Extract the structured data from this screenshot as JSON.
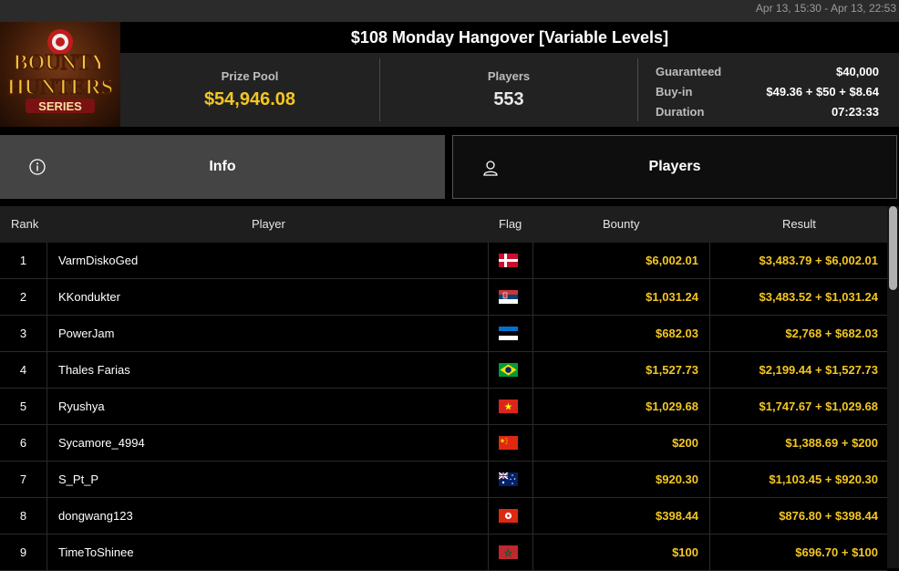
{
  "date_range": "Apr 13, 15:30 - Apr 13, 22:53",
  "logo": {
    "line1": "BOUNTY",
    "line2": "HUNTERS",
    "line3": "SERIES"
  },
  "tournament": {
    "title": "$108 Monday Hangover [Variable Levels]",
    "prize_pool_label": "Prize Pool",
    "prize_pool": "$54,946.08",
    "players_label": "Players",
    "players": "553",
    "guaranteed_label": "Guaranteed",
    "guaranteed": "$40,000",
    "buyin_label": "Buy-in",
    "buyin": "$49.36 + $50 + $8.64",
    "duration_label": "Duration",
    "duration": "07:23:33"
  },
  "tabs": {
    "info": "Info",
    "players": "Players",
    "info_icon": "info-icon",
    "players_icon": "user-icon"
  },
  "table": {
    "headers": {
      "rank": "Rank",
      "player": "Player",
      "flag": "Flag",
      "bounty": "Bounty",
      "result": "Result"
    },
    "rows": [
      {
        "rank": "1",
        "player": "VarmDiskoGed",
        "flag": "denmark",
        "bounty": "$6,002.01",
        "result": "$3,483.79 + $6,002.01"
      },
      {
        "rank": "2",
        "player": "KKondukter",
        "flag": "serbia",
        "bounty": "$1,031.24",
        "result": "$3,483.52 + $1,031.24"
      },
      {
        "rank": "3",
        "player": "PowerJam",
        "flag": "estonia",
        "bounty": "$682.03",
        "result": "$2,768 + $682.03"
      },
      {
        "rank": "4",
        "player": "Thales Farias",
        "flag": "brazil",
        "bounty": "$1,527.73",
        "result": "$2,199.44 + $1,527.73"
      },
      {
        "rank": "5",
        "player": "Ryushya",
        "flag": "vietnam",
        "bounty": "$1,029.68",
        "result": "$1,747.67 + $1,029.68"
      },
      {
        "rank": "6",
        "player": "Sycamore_4994",
        "flag": "china",
        "bounty": "$200",
        "result": "$1,388.69 + $200"
      },
      {
        "rank": "7",
        "player": "S_Pt_P",
        "flag": "australia",
        "bounty": "$920.30",
        "result": "$1,103.45 + $920.30"
      },
      {
        "rank": "8",
        "player": "dongwang123",
        "flag": "hong-kong",
        "bounty": "$398.44",
        "result": "$876.80 + $398.44"
      },
      {
        "rank": "9",
        "player": "TimeToShinee",
        "flag": "morocco",
        "bounty": "$100",
        "result": "$696.70 + $100"
      }
    ]
  },
  "colors": {
    "accent": "#f3c623",
    "active_tab": "#444444",
    "header_bg": "#1e1e1e"
  }
}
